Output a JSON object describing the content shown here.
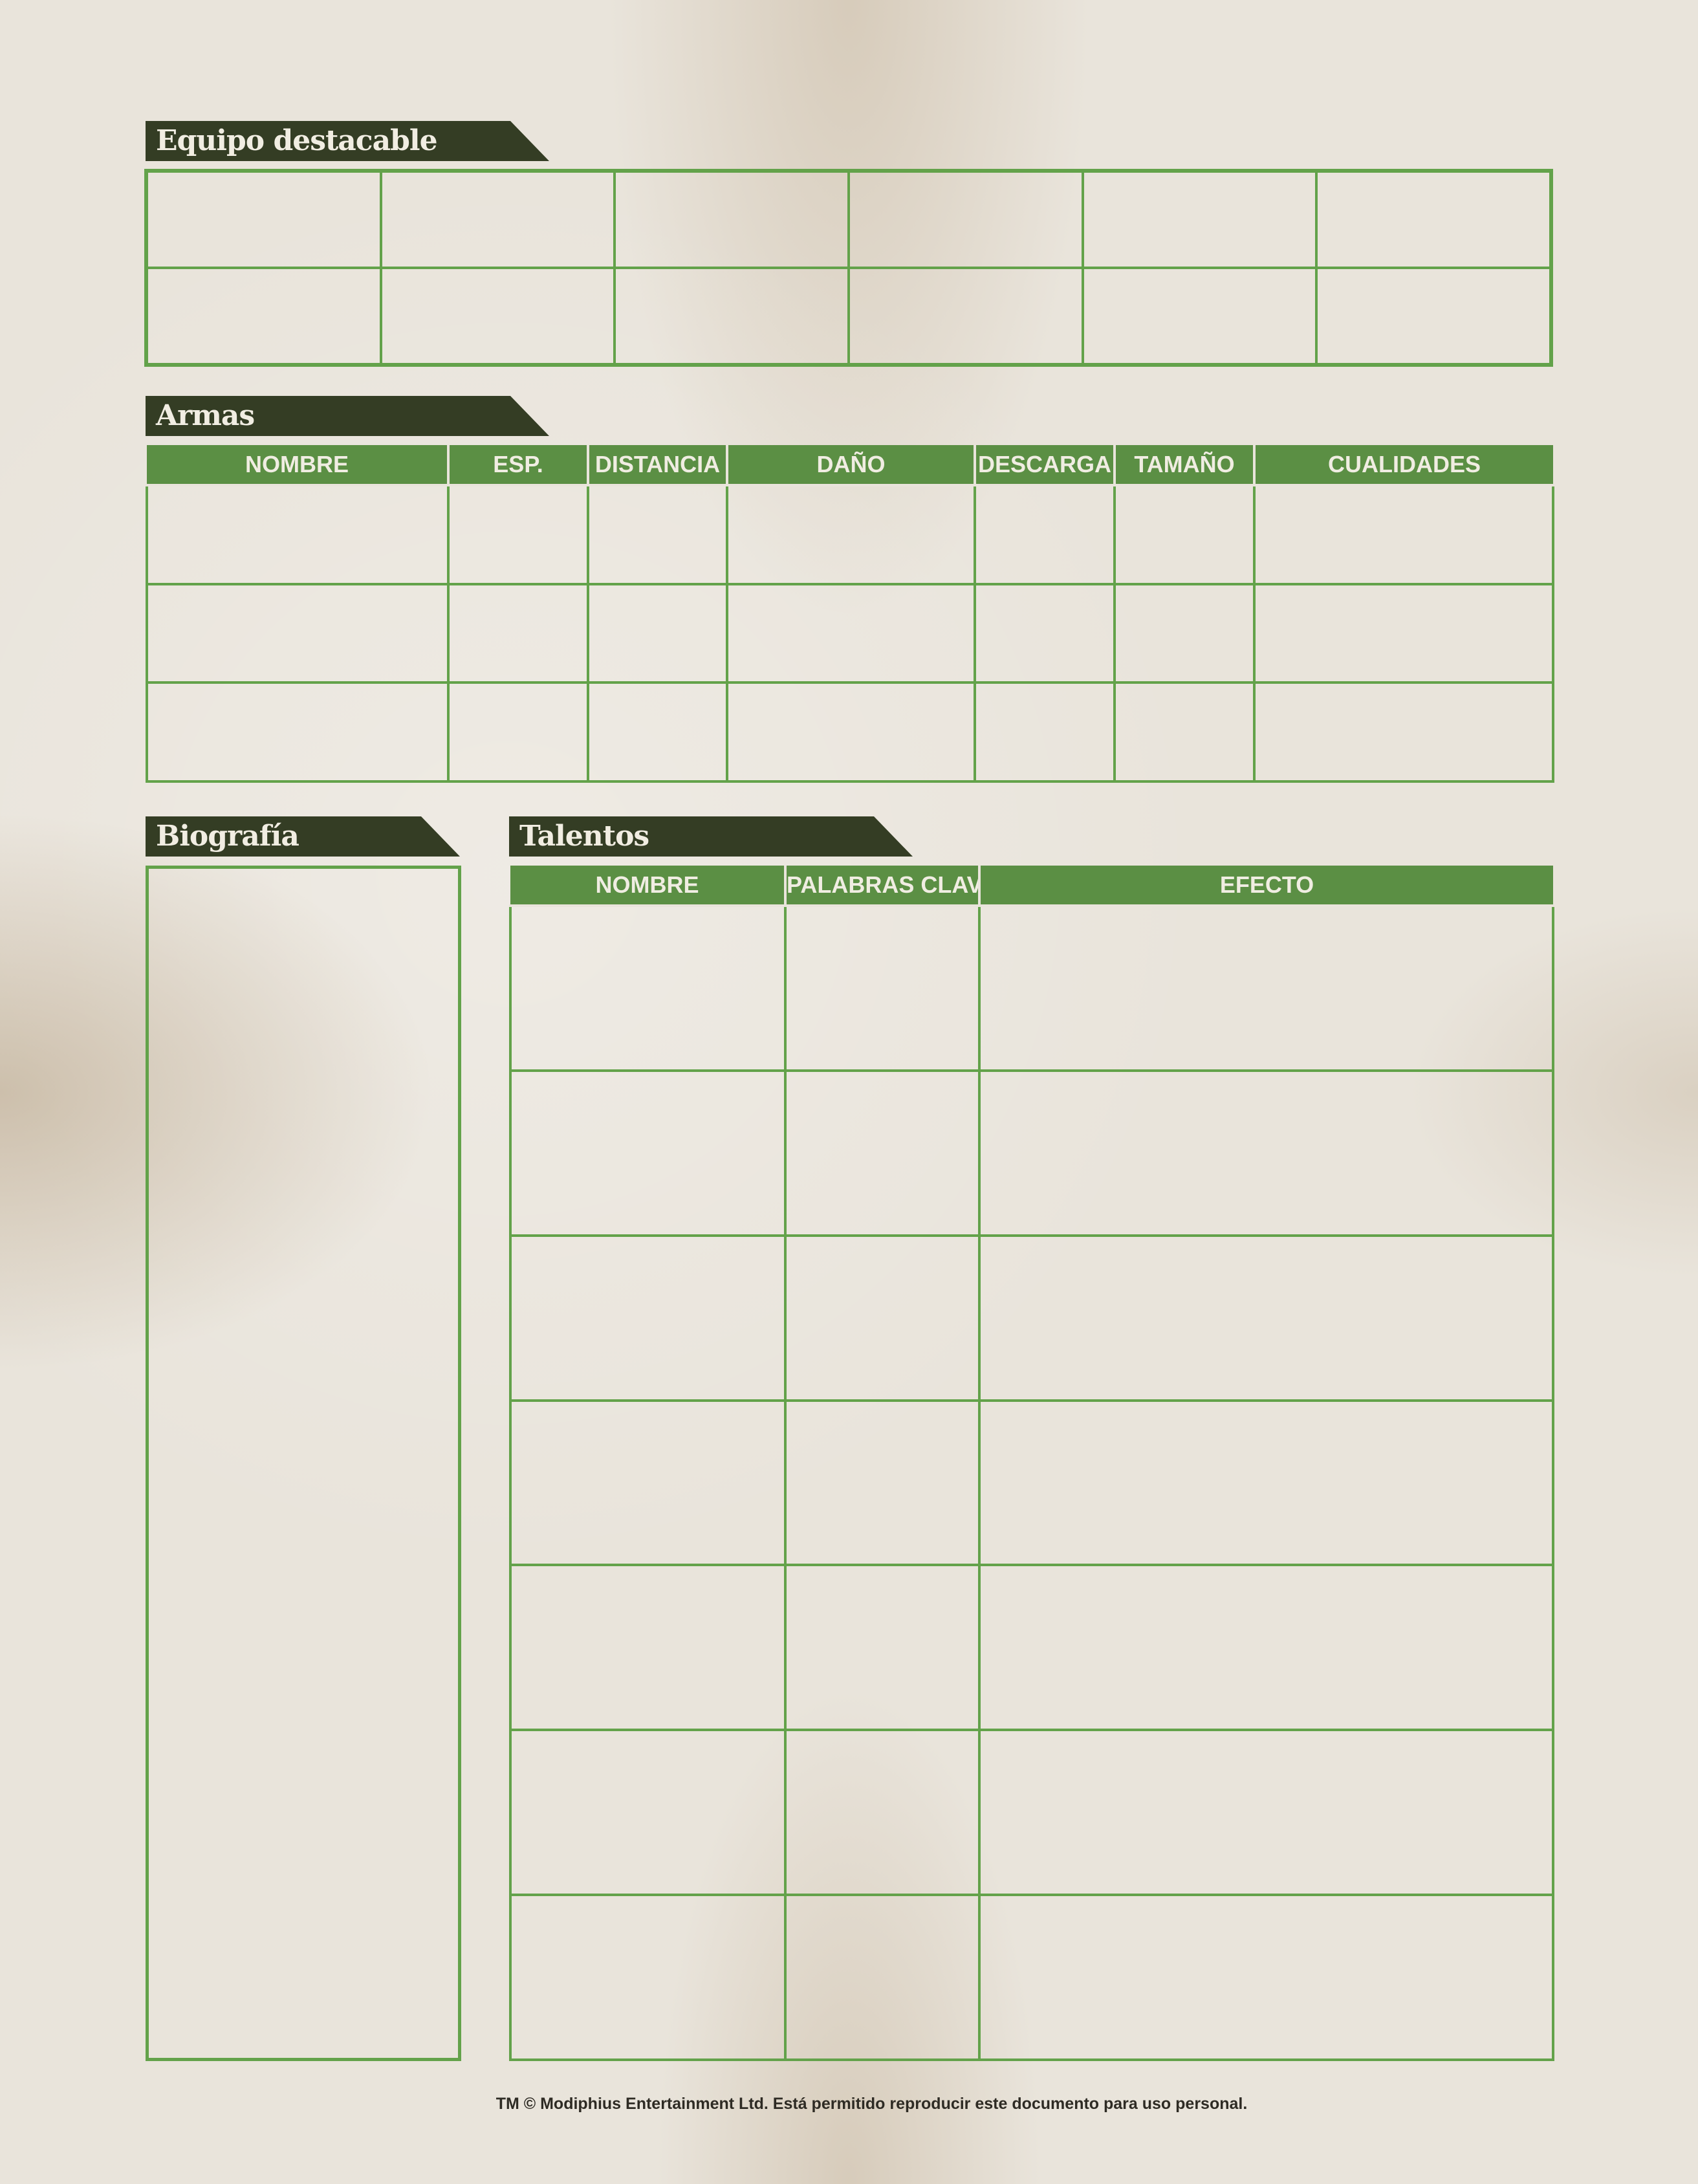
{
  "sections": {
    "equipo": {
      "title": "Equipo destacable"
    },
    "armas": {
      "title": "Armas",
      "columns": [
        "NOMBRE",
        "ESP.",
        "DISTANCIA",
        "DAÑO",
        "DESCARGA",
        "TAMAÑO",
        "CUALIDADES"
      ]
    },
    "biografia": {
      "title": "Biografía"
    },
    "talentos": {
      "title": "Talentos",
      "columns": [
        "NOMBRE",
        "PALABRAS CLAVE",
        "EFECTO"
      ]
    }
  },
  "footer": "TM © Modiphius Entertainment Ltd. Está permitido reproducir este documento para uso personal.",
  "colors": {
    "green": "#63a24a",
    "header_green": "#5b8f44",
    "dark_tab": "#343d24",
    "paper": "#e9e4db"
  }
}
